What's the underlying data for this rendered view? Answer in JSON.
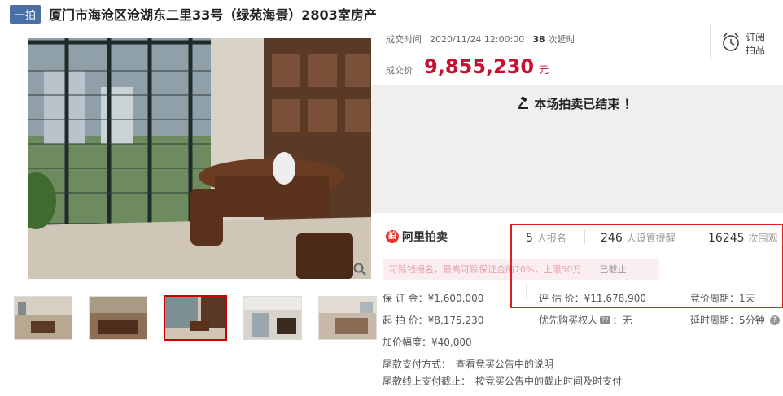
{
  "title": {
    "badge": "一拍",
    "text": "厦门市海沧区沧湖东二里33号（绿苑海景）2803室房产"
  },
  "deal": {
    "time_label": "成交时间",
    "time_value": "2020/11/24 12:00:00",
    "delay_count": "38",
    "delay_label": "次延时",
    "price_label": "成交价",
    "price_value": "9,855,230",
    "price_unit": "元"
  },
  "subscribe": {
    "label_line1": "订阅",
    "label_line2": "拍品",
    "icon": "alarm-clock-icon"
  },
  "status": {
    "ended_text": "本场拍卖已结束 ！",
    "icon": "gavel-icon"
  },
  "platform": {
    "name": "阿里拍卖"
  },
  "stats": [
    {
      "num": "5",
      "unit": "人报名"
    },
    {
      "num": "246",
      "unit": "人设置提醒"
    },
    {
      "num": "16245",
      "unit": "次围观"
    }
  ],
  "notice": {
    "text": "可赊钱报名，最高可赊保证金的70%，上限50万",
    "status": "已截止"
  },
  "details": {
    "deposit_label": "保 证 金：",
    "deposit_value": "¥1,600,000",
    "start_label": "起 拍 价：",
    "start_value": "¥8,175,230",
    "increment_label": "加价幅度：",
    "increment_value": "¥40,000",
    "appraisal_label": "评 估 价：",
    "appraisal_value": "¥11,678,900",
    "priority_label": "优先购买权人",
    "priority_tag": "??",
    "priority_value": "：无",
    "bid_period_label": "竞价周期：",
    "bid_period_value": "1天",
    "extend_period_label": "延时周期：",
    "extend_period_value": "5分钟",
    "help_icon": "?",
    "tail_method_label": "尾款支付方式：",
    "tail_method_value": "查看竞买公告中的说明",
    "tail_deadline_label": "尾款线上支付截止：",
    "tail_deadline_value": "按竞买公告中的截止时间及时支付"
  },
  "colors": {
    "accent": "#c8102e",
    "badge": "#4a6fa5",
    "highlight_box": "#e02020"
  }
}
